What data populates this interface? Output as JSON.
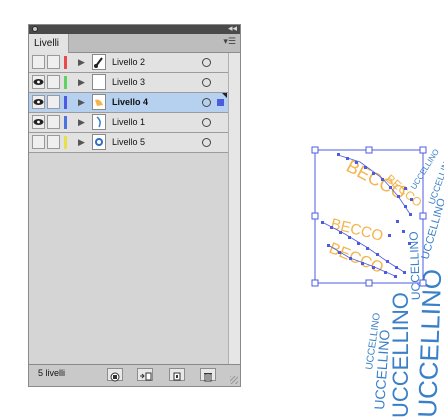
{
  "panel": {
    "tab_label": "Livelli",
    "footer_count": "5 livelli",
    "layers": [
      {
        "name": "Livello 2",
        "eye": false,
        "color": "#e84a4a",
        "thumb": "brush",
        "selected": false
      },
      {
        "name": "Livello 3",
        "eye": true,
        "color": "#5fd35f",
        "thumb": "blank",
        "selected": false
      },
      {
        "name": "Livello 4",
        "eye": true,
        "color": "#4d5be0",
        "thumb": "yellow-shape",
        "selected": true
      },
      {
        "name": "Livello 1",
        "eye": true,
        "color": "#4d73e0",
        "thumb": "blue-shape",
        "selected": false
      },
      {
        "name": "Livello 5",
        "eye": false,
        "color": "#e8e04a",
        "thumb": "bird",
        "selected": false
      }
    ],
    "footer_buttons": [
      "make-clipping-mask-icon",
      "create-sublayer-icon",
      "create-layer-icon",
      "trash-icon"
    ]
  },
  "canvas": {
    "yellow_text": "BECCO",
    "blue_text": "UCCELLINO",
    "selection_color": "#4d5be0",
    "yellow_color": "#f3b54e",
    "blue_color": "#3a80c8"
  }
}
